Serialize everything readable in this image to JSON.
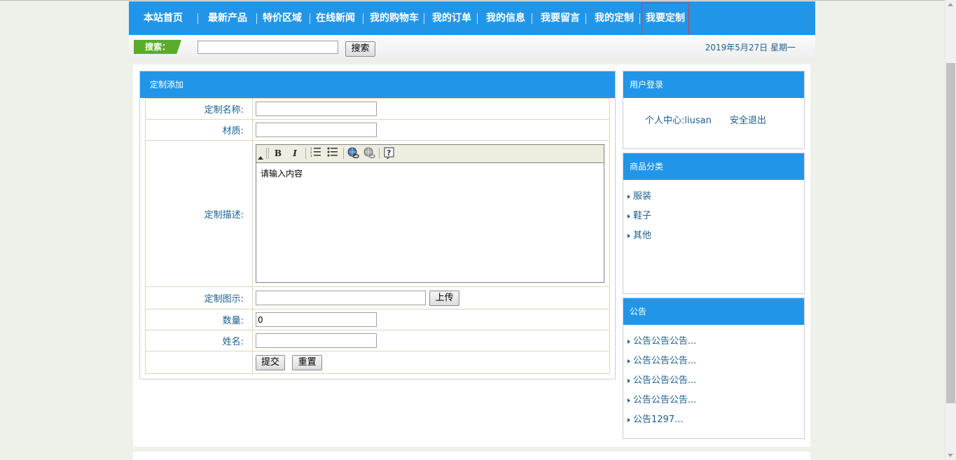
{
  "nav": {
    "items": [
      "本站首页",
      "最新产品",
      "特价区域",
      "在线新闻",
      "我的购物车",
      "我的订单",
      "我的信息",
      "我要留言",
      "我的定制",
      "我要定制"
    ]
  },
  "search": {
    "label": "搜索：",
    "placeholder": "",
    "value": "",
    "button": "搜索",
    "date": "2019年5月27日 星期一"
  },
  "custom_form": {
    "title": "定制添加",
    "name_label": "定制名称:",
    "name_value": "",
    "material_label": "材质:",
    "material_value": "",
    "description_label": "定制描述:",
    "description_placeholder": "请输入内容",
    "image_label": "定制图示:",
    "image_value": "",
    "upload_button": "上传",
    "quantity_label": "数量:",
    "quantity_value": "0",
    "person_label": "姓名:",
    "person_value": "",
    "submit_button": "提交",
    "reset_button": "重置"
  },
  "editor_toolbar": [
    "bold-icon",
    "italic-icon",
    "ordered-list-icon",
    "unordered-list-icon",
    "link-icon",
    "unlink-icon",
    "help-icon"
  ],
  "login_panel": {
    "title": "用户登录",
    "user_prefix": "个人中心:",
    "username": "liusan",
    "logout": "安全退出"
  },
  "category_panel": {
    "title": "商品分类",
    "items": [
      "服装",
      "鞋子",
      "其他"
    ]
  },
  "notice_panel": {
    "title": "公告",
    "items": [
      "公告公告公告...",
      "公告公告公告...",
      "公告公告公告...",
      "公告公告公告...",
      "公告1297..."
    ]
  },
  "colors": {
    "nav_bg": "#2196e9",
    "search_label_bg": "#5aac2c",
    "link_text": "#1b5f8f",
    "active_border": "#e53935"
  }
}
